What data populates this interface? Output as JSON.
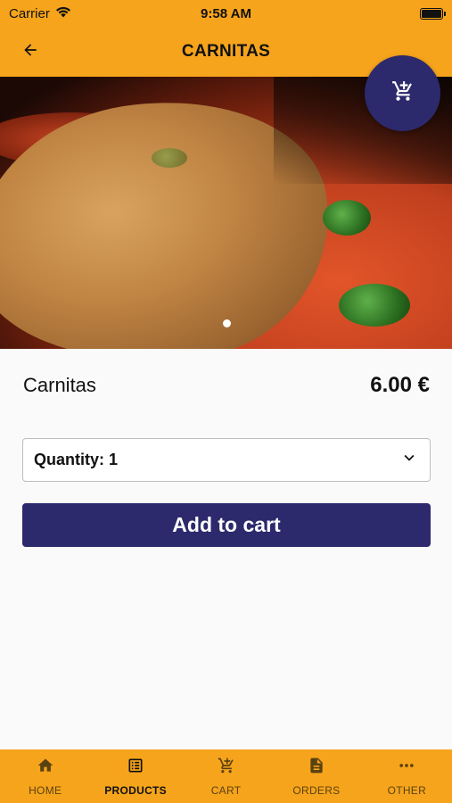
{
  "status_bar": {
    "carrier": "Carrier",
    "time": "9:58 AM"
  },
  "app_bar": {
    "title": "CARNITAS"
  },
  "product": {
    "name": "Carnitas",
    "price": "6.00 €"
  },
  "quantity": {
    "label": "Quantity: 1"
  },
  "actions": {
    "add_to_cart": "Add to cart"
  },
  "tabs": [
    {
      "label": "HOME",
      "icon": "home-icon"
    },
    {
      "label": "PRODUCTS",
      "icon": "list-icon",
      "active": true
    },
    {
      "label": "CART",
      "icon": "cart-icon"
    },
    {
      "label": "ORDERS",
      "icon": "document-icon"
    },
    {
      "label": "OTHER",
      "icon": "more-icon"
    }
  ],
  "colors": {
    "accent": "#f6a41c",
    "primary": "#2c2a6c",
    "background": "#fafafa"
  }
}
